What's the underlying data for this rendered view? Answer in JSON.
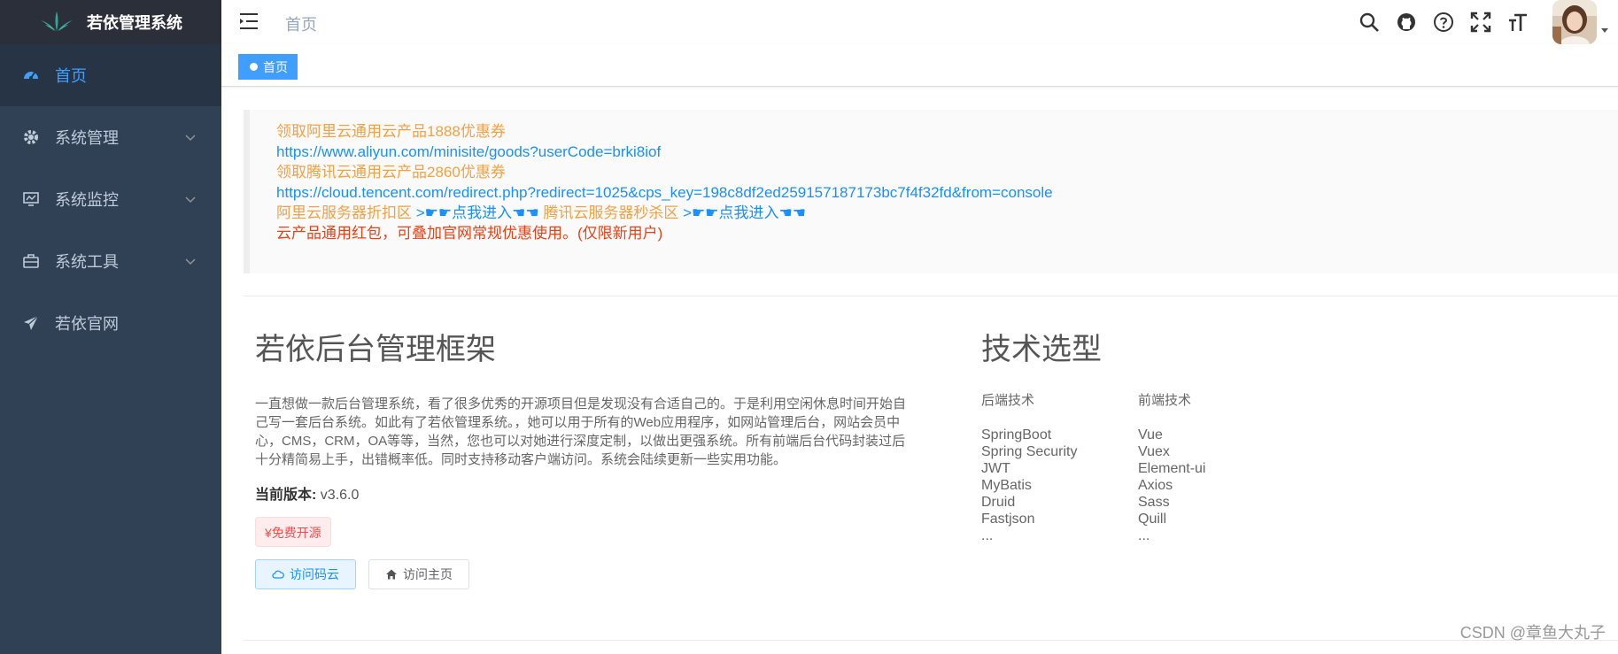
{
  "app": {
    "title": "若依管理系统"
  },
  "sidebar": {
    "items": [
      {
        "label": "首页",
        "icon": "dashboard-icon",
        "active": true,
        "has_children": false
      },
      {
        "label": "系统管理",
        "icon": "gear-icon",
        "active": false,
        "has_children": true
      },
      {
        "label": "系统监控",
        "icon": "monitor-icon",
        "active": false,
        "has_children": true
      },
      {
        "label": "系统工具",
        "icon": "toolbox-icon",
        "active": false,
        "has_children": true
      },
      {
        "label": "若依官网",
        "icon": "send-icon",
        "active": false,
        "has_children": false
      }
    ]
  },
  "navbar": {
    "breadcrumb": "首页",
    "icons": [
      "search-icon",
      "github-icon",
      "question-icon",
      "fullscreen-icon",
      "font-size-icon"
    ]
  },
  "tags": {
    "items": [
      {
        "label": "首页",
        "active": true
      }
    ]
  },
  "notice": {
    "line1": "领取阿里云通用云产品1888优惠券",
    "line2": "https://www.aliyun.com/minisite/goods?userCode=brki8iof",
    "line3": "领取腾讯云通用云产品2860优惠券",
    "line4": "https://cloud.tencent.com/redirect.php?redirect=1025&cps_key=198c8df2ed259157187173bc7f4f32fd&from=console",
    "aliyun_label": "阿里云服务器折扣区",
    "aliyun_link": ">☛☛点我进入☚☚",
    "tencent_label": "腾讯云服务器秒杀区",
    "tencent_link": ">☛☛点我进入☚☚",
    "line6": "云产品通用红包，可叠加官网常规优惠使用。(仅限新用户)"
  },
  "framework": {
    "title": "若依后台管理框架",
    "description": "一直想做一款后台管理系统，看了很多优秀的开源项目但是发现没有合适自己的。于是利用空闲休息时间开始自己写一套后台系统。如此有了若依管理系统。，她可以用于所有的Web应用程序，如网站管理后台，网站会员中心，CMS，CRM，OA等等，当然，您也可以对她进行深度定制，以做出更强系统。所有前端后台代码封装过后十分精简易上手，出错概率低。同时支持移动客户端访问。系统会陆续更新一些实用功能。",
    "version_label": "当前版本:",
    "version": "v3.6.0",
    "free_tag": "¥免费开源",
    "btn_gitee": "访问码云",
    "btn_home": "访问主页"
  },
  "tech": {
    "title": "技术选型",
    "backend": {
      "heading": "后端技术",
      "items": [
        "SpringBoot",
        "Spring Security",
        "JWT",
        "MyBatis",
        "Druid",
        "Fastjson",
        "..."
      ]
    },
    "frontend": {
      "heading": "前端技术",
      "items": [
        "Vue",
        "Vuex",
        "Element-ui",
        "Axios",
        "Sass",
        "Quill",
        "..."
      ]
    }
  },
  "watermark": "CSDN @章鱼大丸子",
  "colors": {
    "sidebar_bg": "#304156",
    "accent": "#409eff",
    "orange": "#f5a041",
    "red": "#ed4014"
  }
}
